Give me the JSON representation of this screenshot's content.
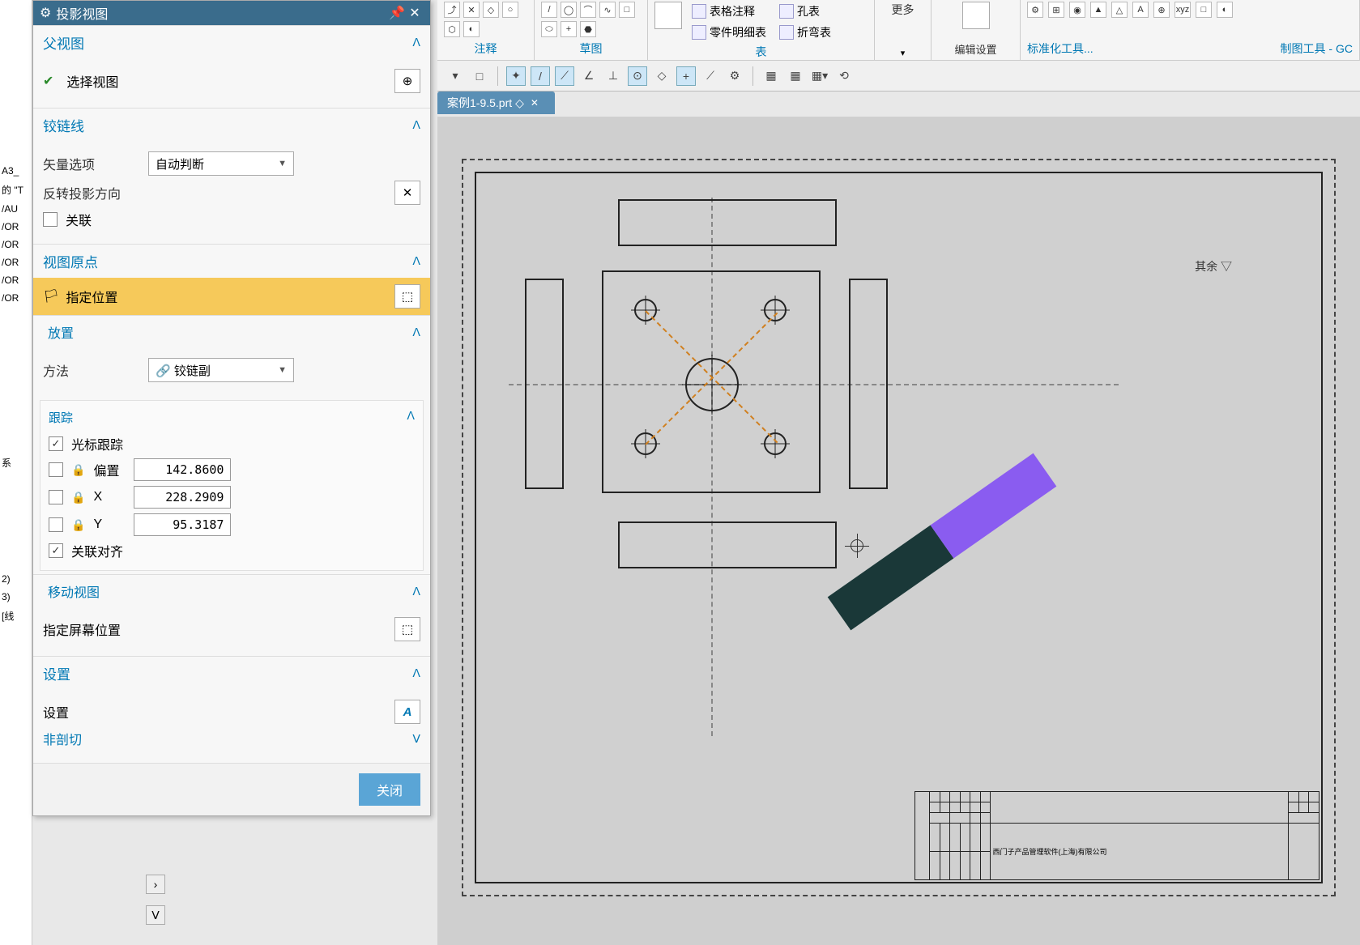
{
  "dialog": {
    "title": "投影视图",
    "sections": {
      "parent": {
        "header": "父视图",
        "select_view": "选择视图"
      },
      "hinge": {
        "header": "铰链线",
        "vector_option_label": "矢量选项",
        "vector_option_value": "自动判断",
        "reverse_label": "反转投影方向",
        "associate_label": "关联"
      },
      "origin": {
        "header": "视图原点",
        "specify_position": "指定位置",
        "placement_header": "放置",
        "method_label": "方法",
        "method_value": "铰链副",
        "tracking_header": "跟踪",
        "cursor_track_label": "光标跟踪",
        "offset_label": "偏置",
        "offset_value": "142.8600",
        "x_label": "X",
        "x_value": "228.2909",
        "y_label": "Y",
        "y_value": "95.3187",
        "assoc_align_label": "关联对齐",
        "move_view_header": "移动视图",
        "screen_pos_label": "指定屏幕位置"
      },
      "settings": {
        "header": "设置",
        "settings_label": "设置",
        "section_mode": "非剖切"
      }
    },
    "close_button": "关闭"
  },
  "filetab": {
    "name": "案例1-9.5.prt",
    "modified": "◇"
  },
  "ribbon": {
    "groups": {
      "annotation": "注释",
      "sketch": "草图",
      "table": "表",
      "more": "更多",
      "std_tools": "标准化工具...",
      "edit_settings": "编辑设置",
      "draft_tools": "制图工具 - GC"
    },
    "items": {
      "table_note": "表格注释",
      "part_list": "零件明细表",
      "hole_table": "孔表",
      "bend_table": "折弯表"
    }
  },
  "tree_items": [
    "A3_",
    "的 \"T",
    "/AU",
    "/OR",
    "/OR",
    "/OR",
    "/OR",
    "/OR"
  ],
  "tree_bottom": [
    "系",
    "2)",
    "3)",
    " [线"
  ],
  "titleblock_text": "西门子产品管理软件(上海)有限公司",
  "stamp_text": "其余 ▽"
}
